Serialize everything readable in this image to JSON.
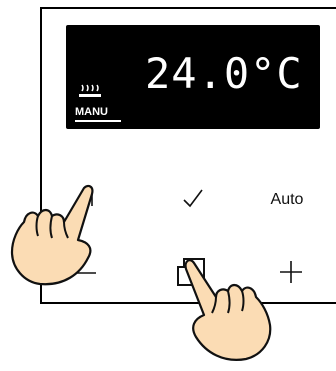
{
  "display": {
    "temperature": "24.0°C",
    "mode": "MANU",
    "heating_icon": "radiator-heating-icon"
  },
  "buttons": {
    "menu_icon": "corner-bracket-icon",
    "confirm_icon": "checkmark-icon",
    "auto_label": "Auto",
    "minus_icon": "minus-icon",
    "windows_icon": "overlapping-squares-icon",
    "plus_icon": "plus-icon"
  },
  "overlays": {
    "left_hand_icon": "pointing-hand-icon",
    "right_hand_icon": "pointing-hand-icon"
  }
}
